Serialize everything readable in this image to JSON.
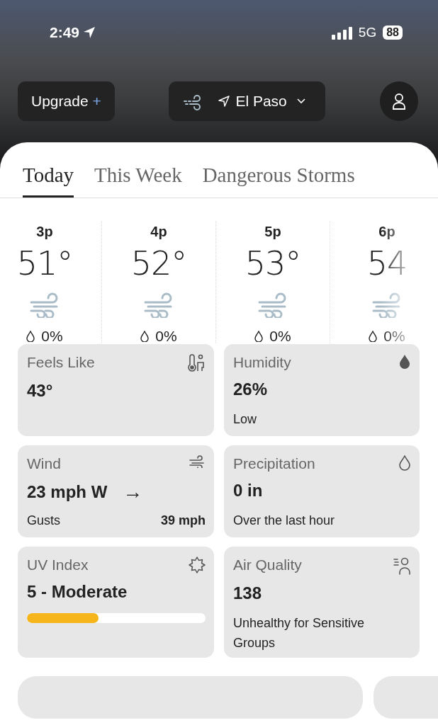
{
  "status_bar": {
    "time": "2:49",
    "network": "5G",
    "battery": "88"
  },
  "header": {
    "upgrade": {
      "label": "Upgrade",
      "plus": "+"
    },
    "location": {
      "name": "El Paso"
    }
  },
  "tabs": [
    {
      "label": "Today",
      "selected": true
    },
    {
      "label": "This Week",
      "selected": false
    },
    {
      "label": "Dangerous Storms",
      "selected": false
    }
  ],
  "hourly": [
    {
      "time": "3p",
      "temp": "51°",
      "precip": "0%"
    },
    {
      "time": "4p",
      "temp": "52°",
      "precip": "0%"
    },
    {
      "time": "5p",
      "temp": "53°",
      "precip": "0%"
    },
    {
      "time": "6p",
      "temp": "54",
      "precip": "0%"
    }
  ],
  "cards": [
    {
      "kind": "plain",
      "title": "Feels Like",
      "value": "43°"
    },
    {
      "kind": "note",
      "title": "Humidity",
      "value": "26%",
      "note": "Low"
    },
    {
      "kind": "wind",
      "title": "Wind",
      "value": "23 mph W",
      "arrow": "→",
      "gusts_label": "Gusts",
      "gusts_value": "39 mph"
    },
    {
      "kind": "note",
      "title": "Precipitation",
      "value": "0 in",
      "note": "Over the last hour"
    },
    {
      "kind": "meter",
      "title": "UV Index",
      "value": "5 - Moderate",
      "level": 0.4
    },
    {
      "kind": "note",
      "title": "Air Quality",
      "value": "138",
      "note": "Unhealthy for Sensitive Groups"
    }
  ]
}
